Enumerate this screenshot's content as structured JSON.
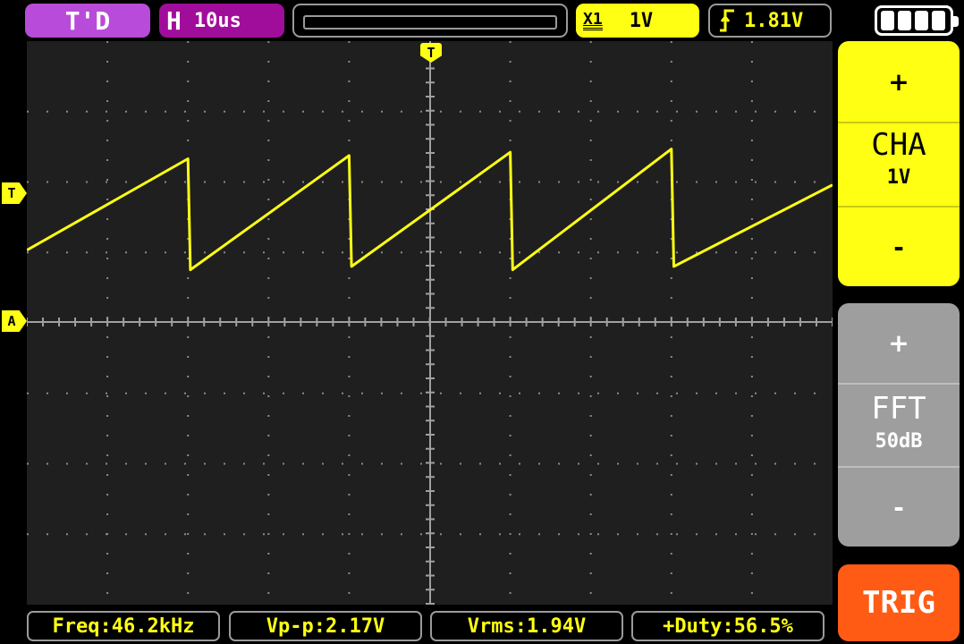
{
  "top_bar": {
    "mode": "T'D",
    "timebase_prefix": "H",
    "timebase": "10us",
    "coupling_symbol": "X1",
    "volts_per_div": "1V",
    "trigger_edge_icon": "rising-edge-icon",
    "trigger_level": "1.81V",
    "battery_icon": "battery-full-icon"
  },
  "markers": {
    "trigger_position": "T",
    "trigger_level": "T",
    "channel_ground": "A"
  },
  "channel_panel": {
    "plus": "+",
    "name": "CHA",
    "scale": "1V",
    "minus": "-"
  },
  "fft_panel": {
    "plus": "+",
    "name": "FFT",
    "scale": "50dB",
    "minus": "-"
  },
  "trig_button": "TRIG",
  "measurements": {
    "freq": "Freq:46.2kHz",
    "vpp": "Vp-p:2.17V",
    "vrms": "Vrms:1.94V",
    "duty": "+Duty:56.5%"
  },
  "colors": {
    "trace": "#ffff14",
    "grid": "#8a8a8a",
    "screen_bg": "#1f1f1f",
    "trig_button": "#ff5b14"
  },
  "chart_data": {
    "type": "line",
    "series": [
      {
        "x_us": [
          0,
          20,
          20.3,
          40,
          40.3,
          60,
          60.3,
          80,
          80.3,
          100
        ],
        "y_v": [
          1.1,
          2.5,
          0.8,
          2.55,
          0.85,
          2.6,
          0.8,
          2.65,
          0.85,
          2.1
        ]
      }
    ],
    "x_divisions": 10,
    "x_units_per_div": "10us",
    "y_units_per_div": "1V",
    "grid": true
  }
}
